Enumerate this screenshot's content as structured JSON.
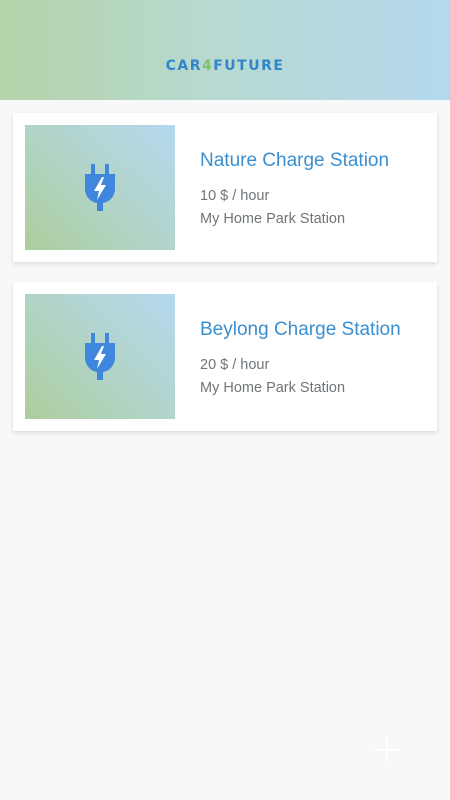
{
  "header": {
    "logo_part1": "CAR",
    "logo_part2": "4",
    "logo_part3": "FUTURE"
  },
  "stations": [
    {
      "name": "Nature Charge Station",
      "price": "10 $ / hour",
      "location": "My Home Park Station",
      "icon": "charging-plug-icon"
    },
    {
      "name": "Beylong Charge Station",
      "price": "20 $ / hour",
      "location": "My Home Park Station",
      "icon": "charging-plug-icon"
    }
  ],
  "fab": {
    "icon": "plus-icon"
  },
  "colors": {
    "accent": "#3a8fd0",
    "logo_blue": "#2f86c9",
    "logo_green": "#7fc36a",
    "icon_blue": "#3f86dd",
    "background": "#f6f8fa"
  }
}
